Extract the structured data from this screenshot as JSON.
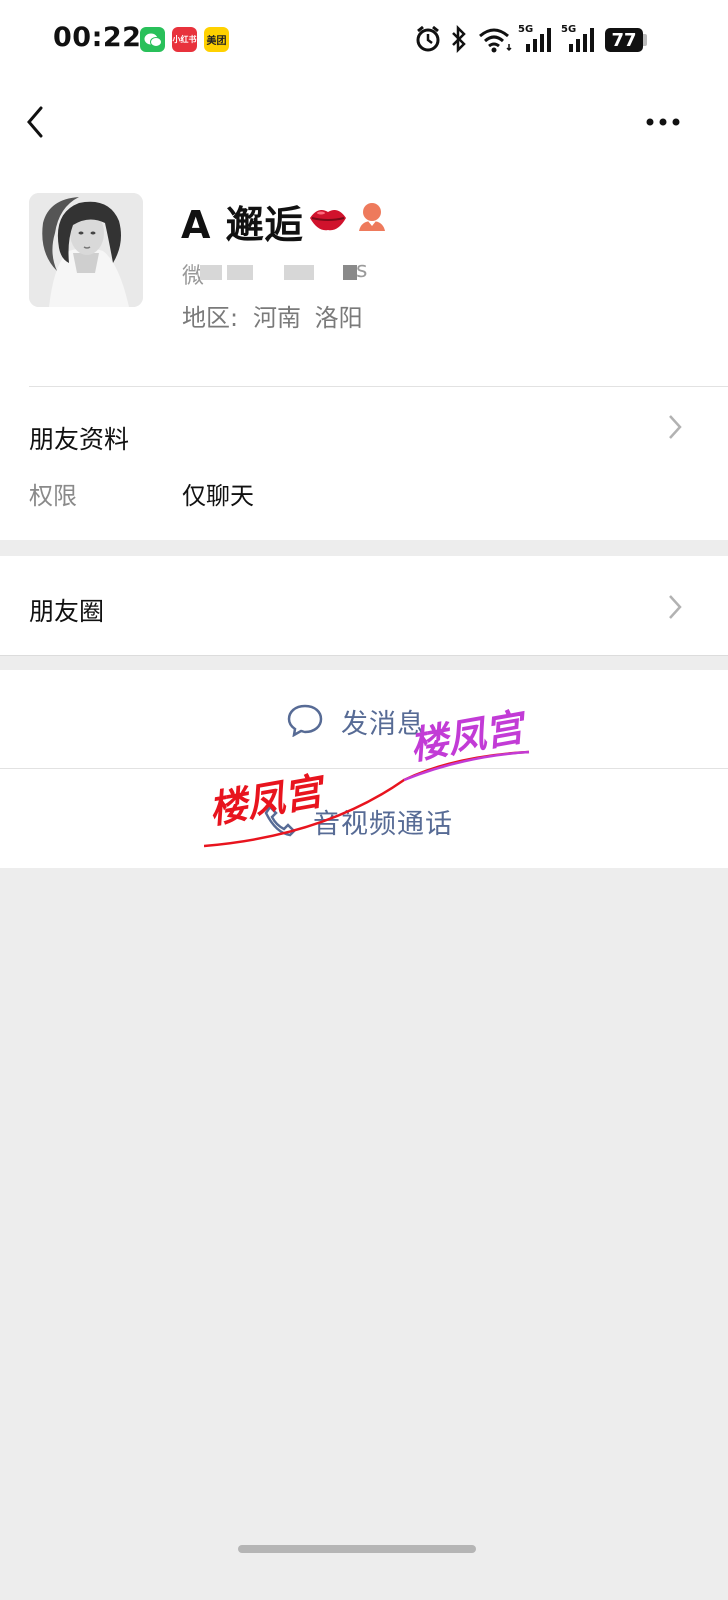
{
  "status_bar": {
    "time": "00:22",
    "apps": [
      "wechat-icon",
      "xiaohongshu-icon",
      "meituan-icon"
    ],
    "meituan_label": "美团",
    "xiaohongshu_label": "小红书",
    "network_label": "5G",
    "battery": "77"
  },
  "profile": {
    "name": "A 邂逅",
    "wechat_id_prefix": "微",
    "wechat_id_suffix": "s",
    "region_label": "地区:",
    "region_value": "河南 洛阳"
  },
  "friend_info": {
    "title": "朋友资料",
    "permission_label": "权限",
    "permission_value": "仅聊天"
  },
  "moments": {
    "title": "朋友圈"
  },
  "actions": {
    "message": "发消息",
    "call": "音视频通话"
  },
  "watermarks": {
    "text_1": "楼凤宫",
    "text_2": "楼凤宫"
  },
  "colors": {
    "link_blue": "#576b95",
    "background": "#ededed",
    "watermark_red": "#e8141e",
    "watermark_purple": "#c23bd6"
  }
}
